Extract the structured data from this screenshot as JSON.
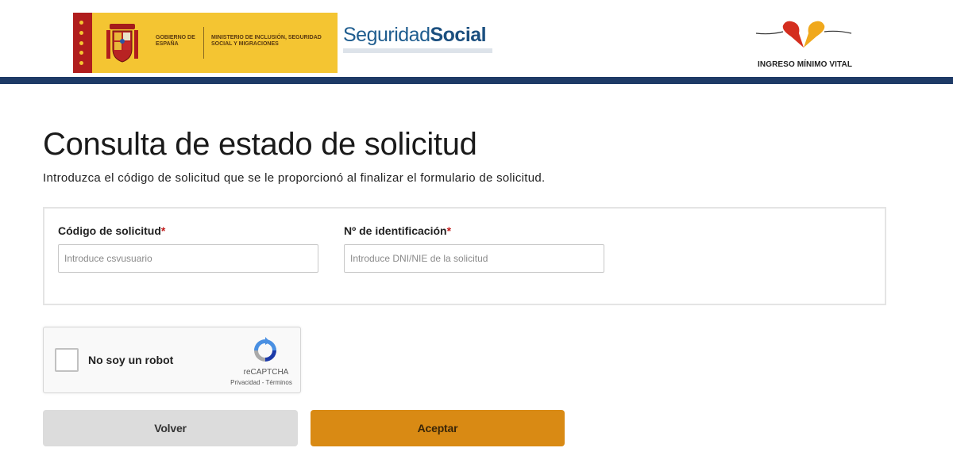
{
  "header": {
    "gov_text_left": "GOBIERNO DE ESPAÑA",
    "gov_text_right": "MINISTERIO DE INCLUSIÓN, SEGURIDAD SOCIAL Y MIGRACIONES",
    "ss_logo_part1": "Seguridad",
    "ss_logo_part2": "Social",
    "imv_label": "INGRESO MÍNIMO VITAL",
    "bar_color": "#1e3a66",
    "banner_color": "#f4c532"
  },
  "main": {
    "title": "Consulta de estado de solicitud",
    "subtitle": "Introduzca el código de solicitud que se le proporcionó al finalizar el formulario de solicitud."
  },
  "form": {
    "code_label": "Código de solicitud",
    "code_placeholder": "Introduce csvusuario",
    "code_value": "",
    "id_label": "Nº de identificación",
    "id_placeholder": "Introduce DNI/NIE de la solicitud",
    "id_value": "",
    "required_mark": "*"
  },
  "recaptcha": {
    "checked": false,
    "label": "No soy un robot",
    "brand": "reCAPTCHA",
    "links": "Privacidad - Términos"
  },
  "buttons": {
    "back_label": "Volver",
    "accept_label": "Aceptar",
    "accept_color": "#d98a14"
  }
}
